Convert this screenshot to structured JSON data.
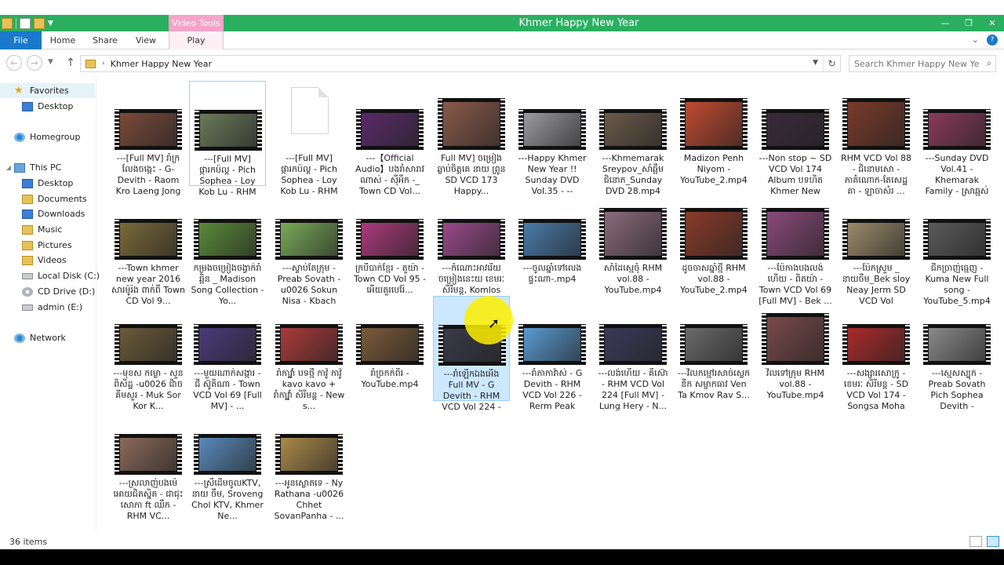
{
  "window": {
    "title": "Khmer Happy New Year",
    "context_tab": "Video Tools",
    "controls": [
      "—",
      "❐",
      "✕"
    ]
  },
  "ribbon": {
    "tabs": [
      "File",
      "Home",
      "Share",
      "View",
      "Play"
    ]
  },
  "address": {
    "path": "Khmer Happy New Year",
    "search_placeholder": "Search Khmer Happy New Year"
  },
  "sidebar": {
    "favorites": "Favorites",
    "desktop_fav": "Desktop",
    "homegroup": "Homegroup",
    "this_pc": "This PC",
    "desktop": "Desktop",
    "documents": "Documents",
    "downloads": "Downloads",
    "music": "Music",
    "pictures": "Pictures",
    "videos": "Videos",
    "local_disk": "Local Disk (C:)",
    "cd_drive": "CD Drive (D:)",
    "admin": "admin (E:)",
    "network": "Network"
  },
  "files": [
    {
      "name": "---[Full MV] រាំក្រលែងចង្កេះ - G-Devith - Raom Kro Laeng Jong ...",
      "color": "#7a4a3a"
    },
    {
      "name": "---[Full MV] ផ្ការកប៉ល្ដ - Pich Sophea - Loy Kob Lu - RHM VCD ...",
      "color": "#6a7a5a"
    },
    {
      "name": "---[Full MV] ផ្ការកប៉ល្ដ - Pich Sophea - Loy Kob Lu - RHM VCD ...",
      "color": "#ffffff"
    },
    {
      "name": "---【Official Audio】បងរាំសារាវណាស់ - សុីអឹក -_ Town CD Vol...",
      "color": "#5a2a6a"
    },
    {
      "name": "Full MV] ចម្រៀងឆ្លាប់ចិត្តគេ នាយ ព្រូន SD VCD 173 Happy...",
      "color": "#8a5a4a"
    },
    {
      "name": "---Happy Khmer New Year !! Sunday DVD Vol.35 - -- ចូលស្ន...",
      "color": "#9a9aa0"
    },
    {
      "name": "---Khmemarak Sreypov_សាំ​ឆ្អឹ​ម​ជិនោភ​_Sunday DVD 28.mp4",
      "color": "#6a5a4a"
    },
    {
      "name": "Madizon Penh Niyom - YouTube_2.mp4",
      "color": "#c04a30"
    },
    {
      "name": "---Non stop ~ SD VCD Vol 174 Album បទហិត Khmer New Yea...",
      "color": "#3a2a3a"
    },
    {
      "name": "RHM VCD Vol 88 - ជិនោមសោ - ភាគំណោក-តែសេដ្ឋ គា - ឡាចាសំរ ...",
      "color": "#7a3a2a"
    },
    {
      "name": "---Sunday DVD Vol.41 - Khemarak Family - ស្រាឆ្មស់ទឹក ...",
      "color": "#8a3a5a"
    },
    {
      "name": "---Town khmer new year 2016 សារម៉ូរ៉ង ពាក់ពី Town CD Vol 9...",
      "color": "#7a6a3a"
    },
    {
      "name": "កម្រងចម្រៀងចង្វាក់រាំឆ្អិន _ Madison Song Collection - Yo...",
      "color": "#5a8a3a"
    },
    {
      "name": "---ស្ទាប់តែក្រុម - Preab Sovath -u0026 Sokun Nisa - Kbach Be...",
      "color": "#7aaa5a"
    },
    {
      "name": "ក្របីបាក់ខ្មែរ - តួយ៉ា - Town CD Vol 95 - អើយតួរបេរ៉ែ...",
      "color": "#aa3a7a"
    },
    {
      "name": "---កំណោះអាវរើយ ចម្រៀងនេះយ ខេមរៈ សិរីមន្ត, Komlos Ort Lit ...",
      "color": "#9a4a8a"
    },
    {
      "name": "---ចូលឆ្នាំទៅលេងផ្ទះណា-.mp4",
      "color": "#4a7aaa"
    },
    {
      "name": "សាំដៃស្មេចុំ RHM vol.88 - YouTube.mp4",
      "color": "#8a6a7a"
    },
    {
      "name": "ដូចចាសឆ្នាំថ្មី RHM vol.88 - YouTube_2.mp4",
      "color": "#8a3a2a"
    },
    {
      "name": "---ប៉ែកាងបងលង់ហើយ - ពិតយ៉ា - Town VCD Vol 69 [Full MV] - Bek ...",
      "color": "#8a4a7a"
    },
    {
      "name": "---ប៉ែកស្រួម _ នាយចឺម_Bek sloy Neay Jerm SD VCD Vol 211(Thai So...",
      "color": "#9a8a6a"
    },
    {
      "name": "ជីកច្រាញ់ធ្មេញ - Kuma New Full song - YouTube_5.mp4",
      "color": "#5a5a5a"
    },
    {
      "name": "---មុខស កម្លោ - សួន ពិសិដ្ឋ -u0026 ជិាច គីមសួរ - Muk Sor Kor K...",
      "color": "#6a5a3a"
    },
    {
      "name": "---មួយណាក់សង្ការ - ជី ស៊ូតិណា - Town VCD Vol 69 [Full MV] - ...",
      "color": "#4a3a7a"
    },
    {
      "name": "រាំកាវ្ឆ្នាំ បទថ្មី កាវ៉ូ កាវ៉ូ kavo kavo + រាំកាវ្ឆ្នាំ សិរីមន្ត - New s...",
      "color": "#aa3a3a"
    },
    {
      "name": "រាំច្រកក់ពីរ - YouTube.mp4",
      "color": "#7a5a3a"
    },
    {
      "name": "---រាំឡើកឯងអើង Full MV - G Devith - RHM VCD Vol 224 - K...",
      "color": "#3a3a4a"
    },
    {
      "name": "---រាំភាកាវ៉ាស់ - G Devith - RHM VCD Vol 226 - Rerm Peak Mas...",
      "color": "#5a9ad0"
    },
    {
      "name": "---លង់ហើយ - គឺស៊ោ - RHM VCD Vol 224 [Full MV] - Lung Hery - N...",
      "color": "#3a3a5a"
    },
    {
      "name": "---វិលកម្មៅរសាច់ស្លេក ឌីក សម្ចាកធាវ Ven Ta Kmov Rav S...",
      "color": "#6a6a6a"
    },
    {
      "name": "វិលទៅក្រុម RHM vol.88 - YouTube.mp4",
      "color": "#7a4a4a"
    },
    {
      "name": "---សង្សារសោក្រូ - ខេមរៈ សិរីមន្ត - SD VCD Vol 174 - Songsa Moha K...",
      "color": "#aa2a2a"
    },
    {
      "name": "---ស្មេសស្បុក - Preab Sovath Pich Sophea Devith - Somlor...",
      "color": "#8a8a8a"
    },
    {
      "name": "---ស្រលាញ់បងម៉េអោយជិតស្និត - ជាជុះ សោភា ft ឈឹក - RHM VC...",
      "color": "#8a6a5a"
    },
    {
      "name": "---ស្រីដើមចូលKTV, នាយ ចឺម, Sroveng Chol KTV, Khmer Ne...",
      "color": "#5a8aba"
    },
    {
      "name": "---អូនស្លោតទេ - Ny Rathana -u0026 Chhet SovanPanha - ...",
      "color": "#aa8a4a"
    }
  ],
  "status": {
    "count": "36 items"
  }
}
